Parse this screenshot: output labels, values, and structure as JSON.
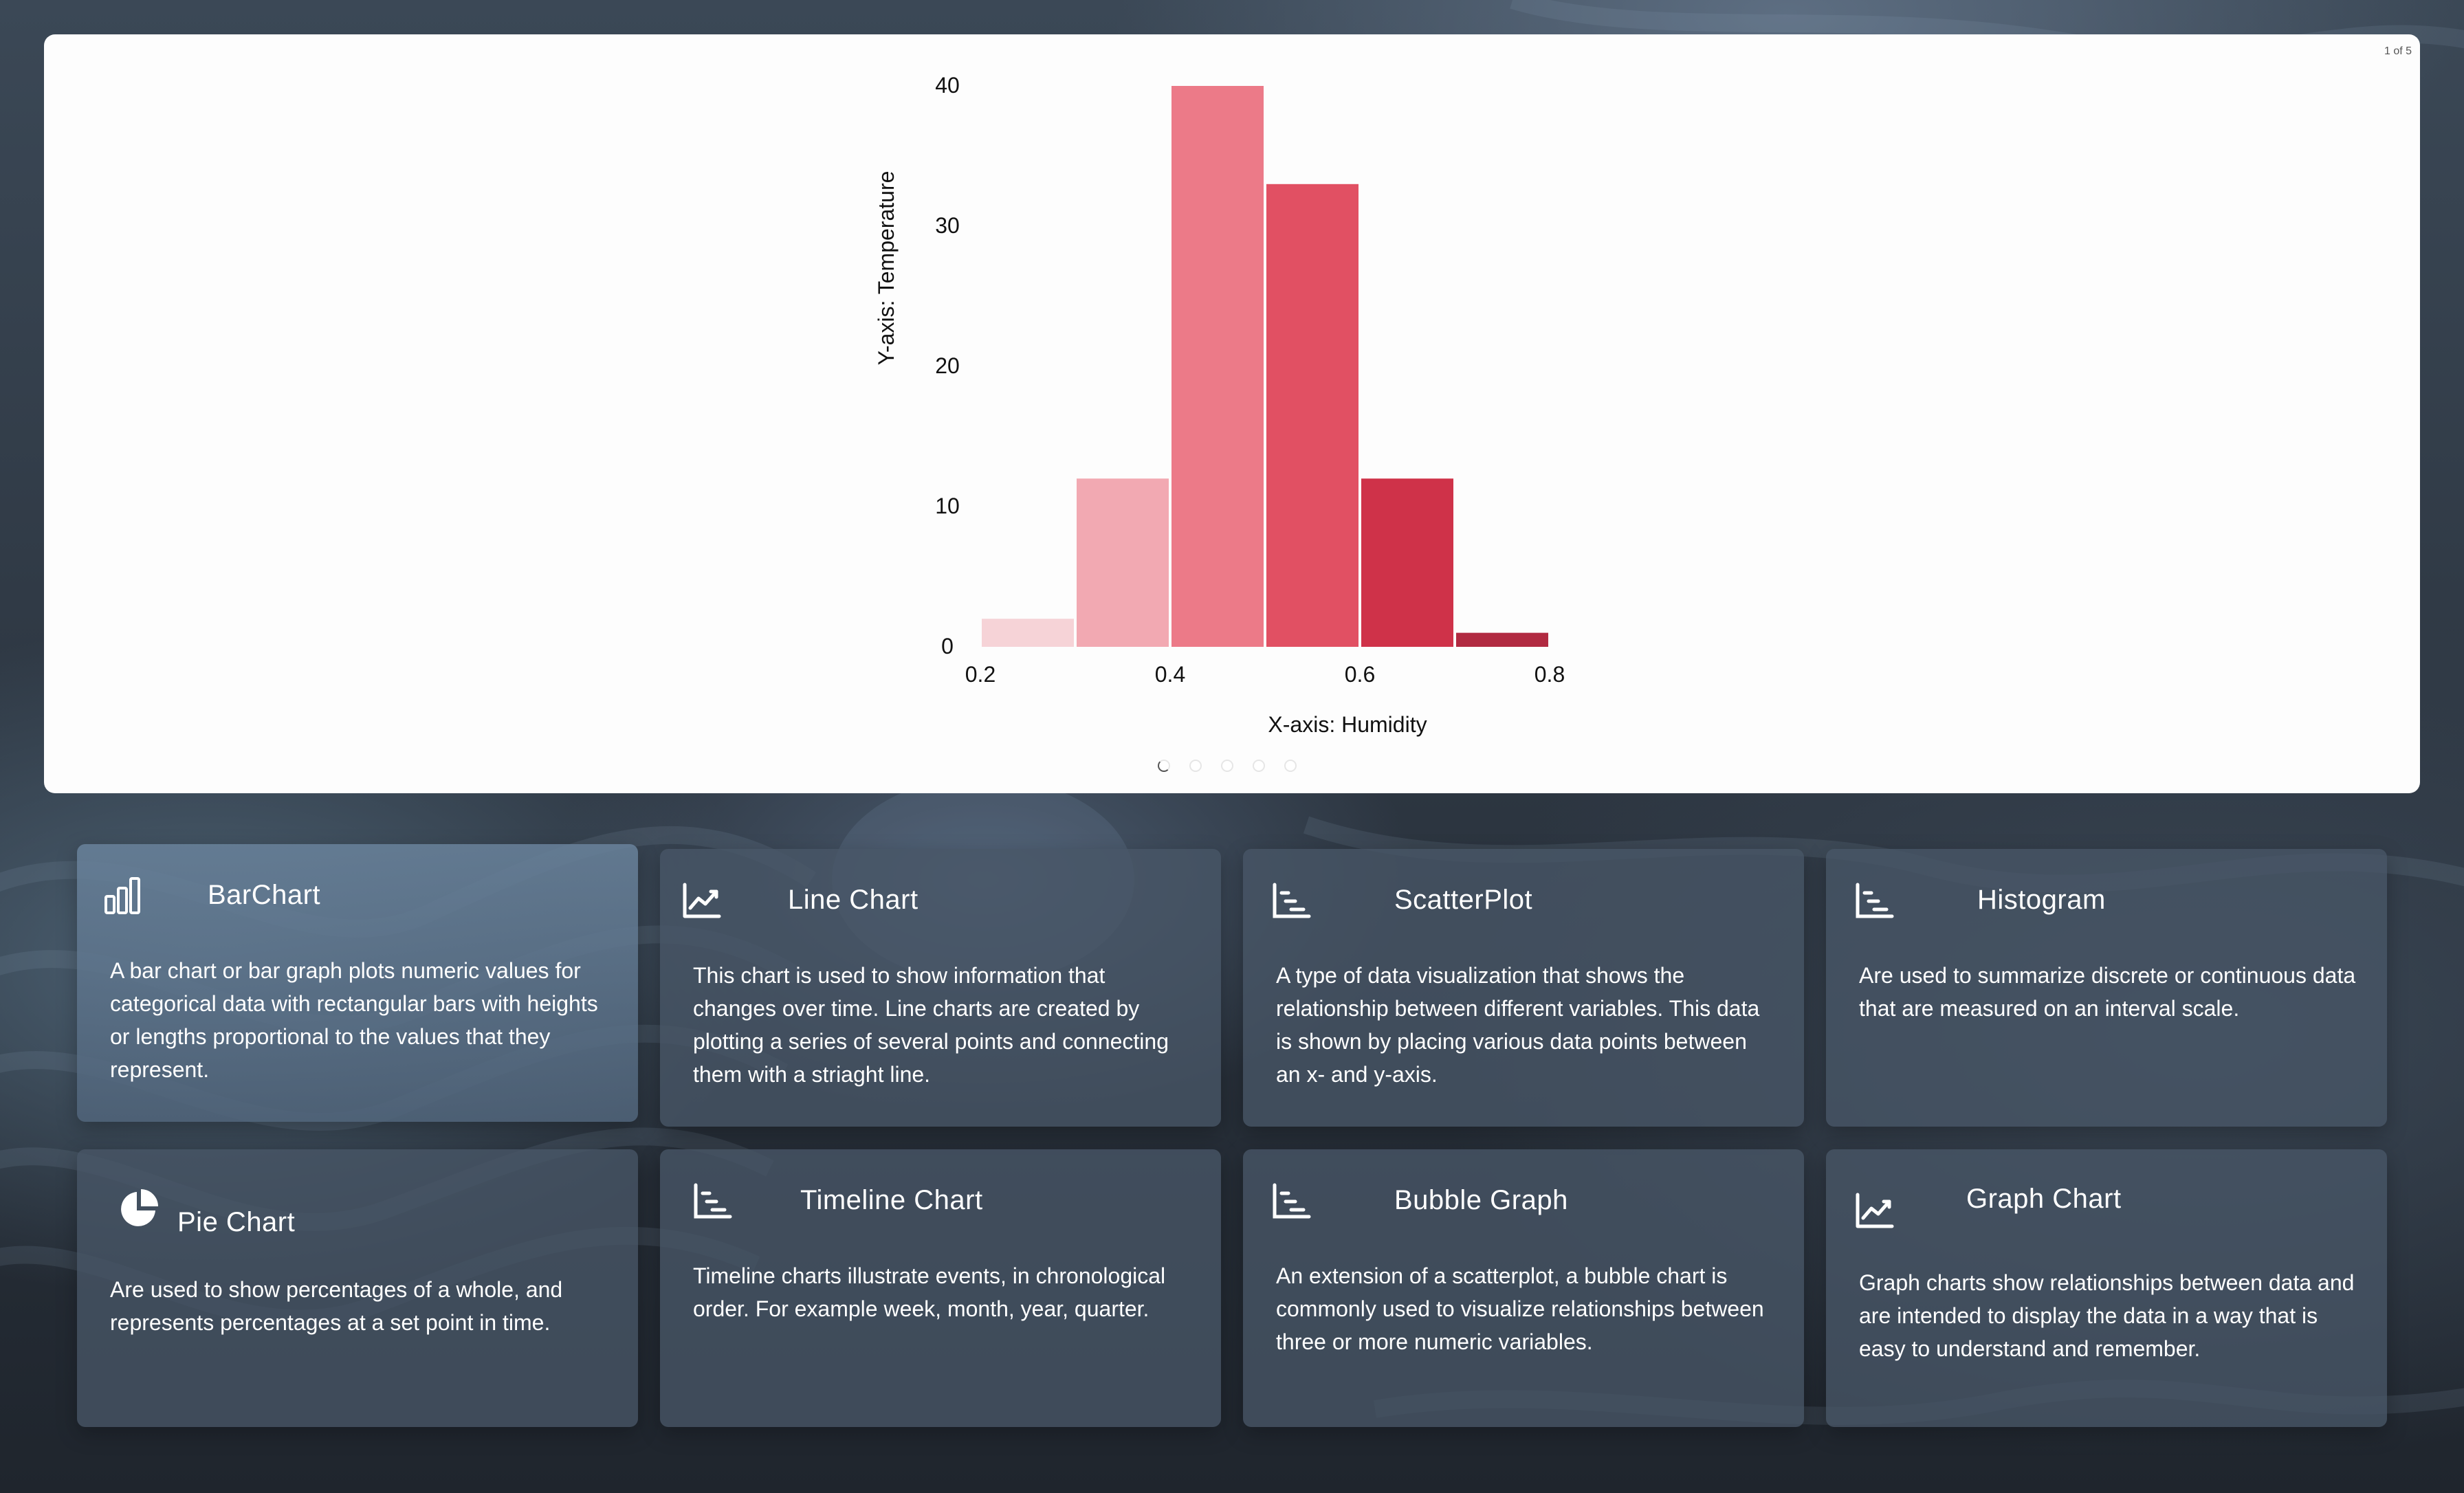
{
  "carousel": {
    "page_indicator": "1 of 5",
    "dot_count": 5,
    "active_dot": 0
  },
  "chart_data": {
    "type": "bar",
    "title": "",
    "xlabel": "X-axis: Humidity",
    "ylabel": "Y-axis: Temperature",
    "bins": [
      {
        "x0": 0.2,
        "x1": 0.3,
        "value": 2,
        "color": "#f6d3d7"
      },
      {
        "x0": 0.3,
        "x1": 0.4,
        "value": 12,
        "color": "#f2a9b2"
      },
      {
        "x0": 0.4,
        "x1": 0.5,
        "value": 40,
        "color": "#ec7a88"
      },
      {
        "x0": 0.5,
        "x1": 0.6,
        "value": 33,
        "color": "#e15063"
      },
      {
        "x0": 0.6,
        "x1": 0.7,
        "value": 12,
        "color": "#cf3249"
      },
      {
        "x0": 0.7,
        "x1": 0.8,
        "value": 1,
        "color": "#b12a41"
      }
    ],
    "xlim": [
      0.2,
      0.8
    ],
    "ylim": [
      0,
      40
    ],
    "xticks": [
      "0.2",
      "0.4",
      "0.6",
      "0.8"
    ],
    "yticks": [
      "0",
      "10",
      "20",
      "30",
      "40"
    ],
    "grid": false,
    "legend": "none"
  },
  "cards": [
    {
      "icon": "bar-chart-icon",
      "title": "BarChart",
      "description": "A bar chart or bar graph plots numeric values for categorical data with rectangular bars with heights or lengths proportional to the values that they represent."
    },
    {
      "icon": "line-chart-icon",
      "title": "Line Chart",
      "description": "This chart is used to show information that changes over time. Line charts are created by plotting a series of several points and connecting them with a striaght line."
    },
    {
      "icon": "scatter-icon",
      "title": "ScatterPlot",
      "description": "A type of data visualization that shows the relationship between different variables. This data is shown by placing various data points between an x- and y-axis."
    },
    {
      "icon": "histogram-icon",
      "title": "Histogram",
      "description": "Are used to summarize discrete or continuous data that are measured on an interval scale."
    },
    {
      "icon": "pie-chart-icon",
      "title": "Pie Chart",
      "description": "Are used to show percentages of a whole, and represents percentages at a set point in time."
    },
    {
      "icon": "timeline-icon",
      "title": "Timeline Chart",
      "description": "Timeline charts illustrate events, in chronological order. For example week, month, year, quarter."
    },
    {
      "icon": "bubble-icon",
      "title": "Bubble Graph",
      "description": "An extension of a scatterplot, a bubble chart is commonly used to visualize relationships between three or more numeric variables."
    },
    {
      "icon": "graph-chart-icon",
      "title": "Graph Chart",
      "description": "Graph charts show relationships between data and are intended to display the data in a way that is easy to understand and remember."
    }
  ]
}
